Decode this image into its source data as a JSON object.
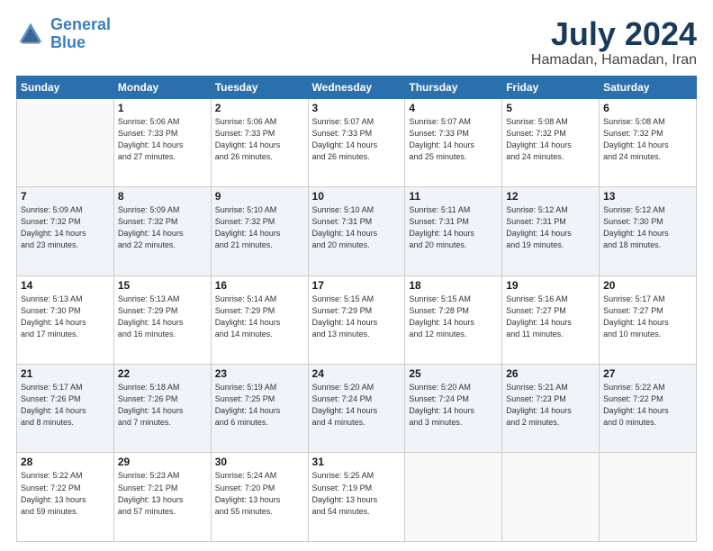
{
  "header": {
    "logo_line1": "General",
    "logo_line2": "Blue",
    "title": "July 2024",
    "subtitle": "Hamadan, Hamadan, Iran"
  },
  "days_of_week": [
    "Sunday",
    "Monday",
    "Tuesday",
    "Wednesday",
    "Thursday",
    "Friday",
    "Saturday"
  ],
  "weeks": [
    [
      {
        "day": "",
        "info": ""
      },
      {
        "day": "1",
        "info": "Sunrise: 5:06 AM\nSunset: 7:33 PM\nDaylight: 14 hours\nand 27 minutes."
      },
      {
        "day": "2",
        "info": "Sunrise: 5:06 AM\nSunset: 7:33 PM\nDaylight: 14 hours\nand 26 minutes."
      },
      {
        "day": "3",
        "info": "Sunrise: 5:07 AM\nSunset: 7:33 PM\nDaylight: 14 hours\nand 26 minutes."
      },
      {
        "day": "4",
        "info": "Sunrise: 5:07 AM\nSunset: 7:33 PM\nDaylight: 14 hours\nand 25 minutes."
      },
      {
        "day": "5",
        "info": "Sunrise: 5:08 AM\nSunset: 7:32 PM\nDaylight: 14 hours\nand 24 minutes."
      },
      {
        "day": "6",
        "info": "Sunrise: 5:08 AM\nSunset: 7:32 PM\nDaylight: 14 hours\nand 24 minutes."
      }
    ],
    [
      {
        "day": "7",
        "info": "Sunrise: 5:09 AM\nSunset: 7:32 PM\nDaylight: 14 hours\nand 23 minutes."
      },
      {
        "day": "8",
        "info": "Sunrise: 5:09 AM\nSunset: 7:32 PM\nDaylight: 14 hours\nand 22 minutes."
      },
      {
        "day": "9",
        "info": "Sunrise: 5:10 AM\nSunset: 7:32 PM\nDaylight: 14 hours\nand 21 minutes."
      },
      {
        "day": "10",
        "info": "Sunrise: 5:10 AM\nSunset: 7:31 PM\nDaylight: 14 hours\nand 20 minutes."
      },
      {
        "day": "11",
        "info": "Sunrise: 5:11 AM\nSunset: 7:31 PM\nDaylight: 14 hours\nand 20 minutes."
      },
      {
        "day": "12",
        "info": "Sunrise: 5:12 AM\nSunset: 7:31 PM\nDaylight: 14 hours\nand 19 minutes."
      },
      {
        "day": "13",
        "info": "Sunrise: 5:12 AM\nSunset: 7:30 PM\nDaylight: 14 hours\nand 18 minutes."
      }
    ],
    [
      {
        "day": "14",
        "info": "Sunrise: 5:13 AM\nSunset: 7:30 PM\nDaylight: 14 hours\nand 17 minutes."
      },
      {
        "day": "15",
        "info": "Sunrise: 5:13 AM\nSunset: 7:29 PM\nDaylight: 14 hours\nand 16 minutes."
      },
      {
        "day": "16",
        "info": "Sunrise: 5:14 AM\nSunset: 7:29 PM\nDaylight: 14 hours\nand 14 minutes."
      },
      {
        "day": "17",
        "info": "Sunrise: 5:15 AM\nSunset: 7:29 PM\nDaylight: 14 hours\nand 13 minutes."
      },
      {
        "day": "18",
        "info": "Sunrise: 5:15 AM\nSunset: 7:28 PM\nDaylight: 14 hours\nand 12 minutes."
      },
      {
        "day": "19",
        "info": "Sunrise: 5:16 AM\nSunset: 7:27 PM\nDaylight: 14 hours\nand 11 minutes."
      },
      {
        "day": "20",
        "info": "Sunrise: 5:17 AM\nSunset: 7:27 PM\nDaylight: 14 hours\nand 10 minutes."
      }
    ],
    [
      {
        "day": "21",
        "info": "Sunrise: 5:17 AM\nSunset: 7:26 PM\nDaylight: 14 hours\nand 8 minutes."
      },
      {
        "day": "22",
        "info": "Sunrise: 5:18 AM\nSunset: 7:26 PM\nDaylight: 14 hours\nand 7 minutes."
      },
      {
        "day": "23",
        "info": "Sunrise: 5:19 AM\nSunset: 7:25 PM\nDaylight: 14 hours\nand 6 minutes."
      },
      {
        "day": "24",
        "info": "Sunrise: 5:20 AM\nSunset: 7:24 PM\nDaylight: 14 hours\nand 4 minutes."
      },
      {
        "day": "25",
        "info": "Sunrise: 5:20 AM\nSunset: 7:24 PM\nDaylight: 14 hours\nand 3 minutes."
      },
      {
        "day": "26",
        "info": "Sunrise: 5:21 AM\nSunset: 7:23 PM\nDaylight: 14 hours\nand 2 minutes."
      },
      {
        "day": "27",
        "info": "Sunrise: 5:22 AM\nSunset: 7:22 PM\nDaylight: 14 hours\nand 0 minutes."
      }
    ],
    [
      {
        "day": "28",
        "info": "Sunrise: 5:22 AM\nSunset: 7:22 PM\nDaylight: 13 hours\nand 59 minutes."
      },
      {
        "day": "29",
        "info": "Sunrise: 5:23 AM\nSunset: 7:21 PM\nDaylight: 13 hours\nand 57 minutes."
      },
      {
        "day": "30",
        "info": "Sunrise: 5:24 AM\nSunset: 7:20 PM\nDaylight: 13 hours\nand 55 minutes."
      },
      {
        "day": "31",
        "info": "Sunrise: 5:25 AM\nSunset: 7:19 PM\nDaylight: 13 hours\nand 54 minutes."
      },
      {
        "day": "",
        "info": ""
      },
      {
        "day": "",
        "info": ""
      },
      {
        "day": "",
        "info": ""
      }
    ]
  ]
}
